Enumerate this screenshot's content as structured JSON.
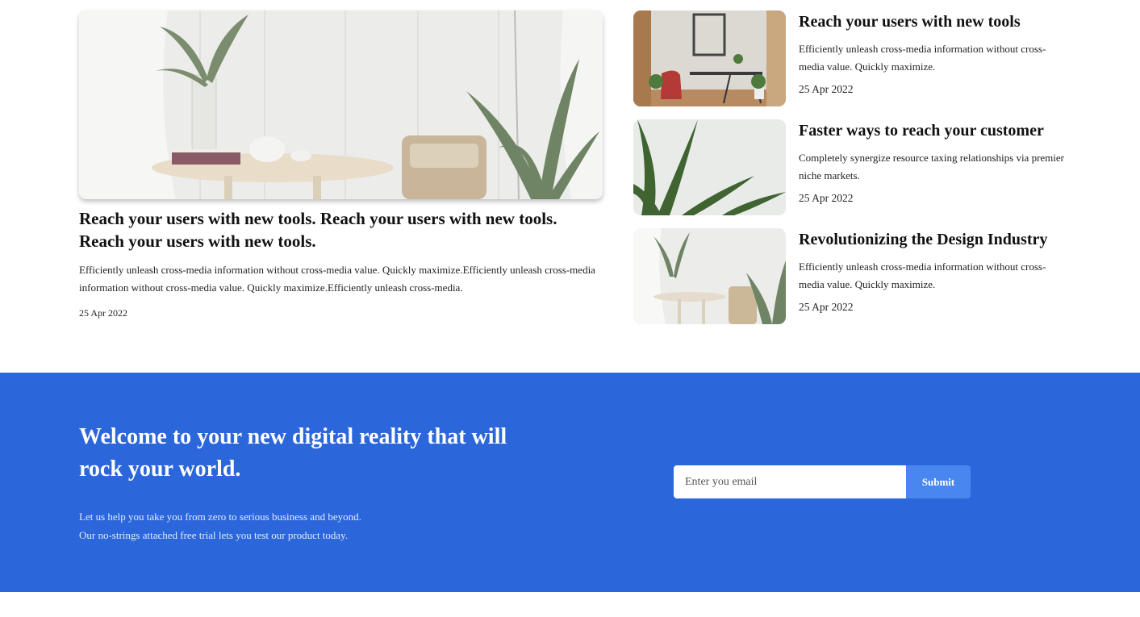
{
  "featured": {
    "title": "Reach your users with new tools. Reach your users with new tools. Reach your users with new tools.",
    "excerpt": "Efficiently unleash cross-media information without cross-media value. Quickly maximize.Efficiently unleash cross-media information without cross-media value. Quickly maximize.Efficiently unleash cross-media.",
    "date": "25 Apr 2022"
  },
  "side_posts": [
    {
      "title": "Reach your users with new tools",
      "excerpt": "Efficiently unleash cross-media information without cross-media value. Quickly maximize.",
      "date": "25 Apr 2022"
    },
    {
      "title": "Faster ways to reach your customer",
      "excerpt": "Completely synergize resource taxing relationships via premier niche markets.",
      "date": "25 Apr 2022"
    },
    {
      "title": "Revolutionizing the Design Industry",
      "excerpt": "Efficiently unleash cross-media information without cross-media value. Quickly maximize.",
      "date": "25 Apr 2022"
    }
  ],
  "cta": {
    "heading": "Welcome to your new digital reality that will rock your world.",
    "sub_line1": "Let us help you take you from zero to serious business and beyond.",
    "sub_line2": "Our no-strings attached free trial lets you test our product today.",
    "email_placeholder": "Enter you email",
    "submit_label": "Submit"
  },
  "colors": {
    "cta_background": "#2b66db",
    "submit_button": "#4a86ef"
  }
}
